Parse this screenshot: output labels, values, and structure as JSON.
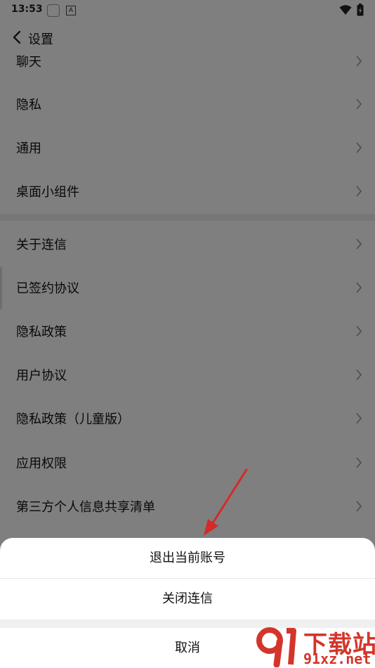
{
  "status_bar": {
    "time": "13:53",
    "a_icon": "A"
  },
  "header": {
    "title": "设置"
  },
  "group1": [
    {
      "label": "聊天"
    },
    {
      "label": "隐私"
    },
    {
      "label": "通用"
    },
    {
      "label": "桌面小组件"
    }
  ],
  "group2": [
    {
      "label": "关于连信"
    },
    {
      "label": "已签约协议"
    },
    {
      "label": "隐私政策"
    },
    {
      "label": "用户协议"
    },
    {
      "label": "隐私政策（儿童版）"
    },
    {
      "label": "应用权限"
    },
    {
      "label": "第三方个人信息共享清单"
    }
  ],
  "sheet": {
    "logout": "退出当前账号",
    "close_app": "关闭连信",
    "cancel": "取消"
  },
  "watermark": {
    "main": "下载站",
    "url": "91xz.net"
  },
  "colors": {
    "annotation_arrow": "#d42a2a",
    "watermark": "#d4352a"
  }
}
